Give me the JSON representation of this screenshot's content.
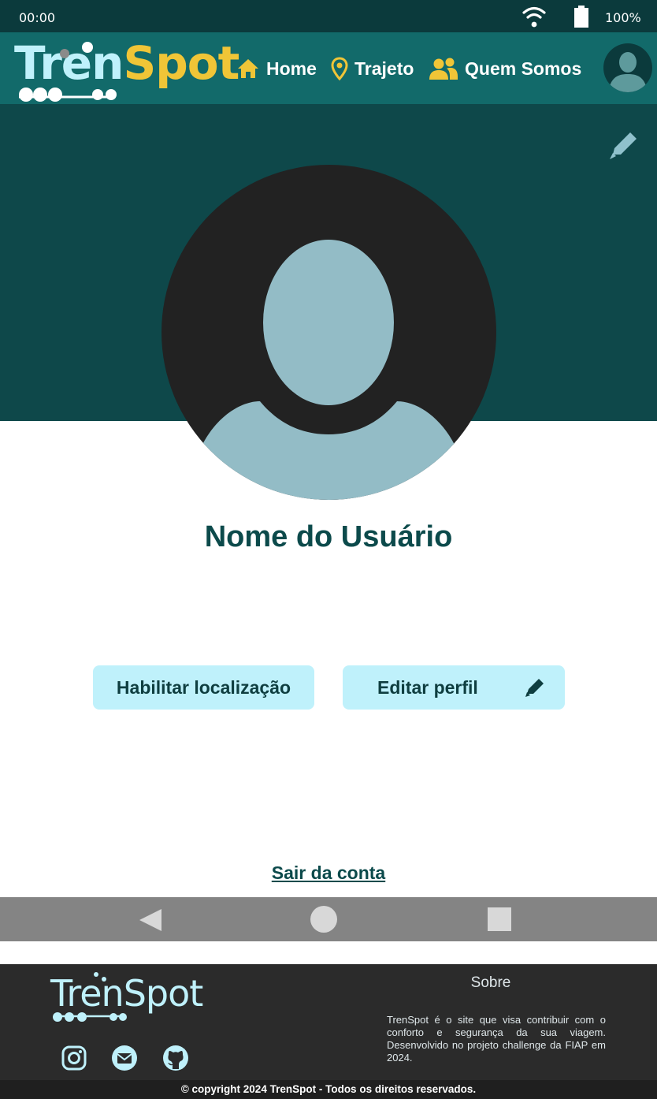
{
  "status_bar": {
    "time": "00:00",
    "battery": "100%",
    "icons": [
      "wifi-icon",
      "battery-icon"
    ]
  },
  "header": {
    "logo": {
      "part1": "Tren",
      "part2": "Spot"
    },
    "nav": [
      {
        "label": "Home",
        "icon": "home-icon"
      },
      {
        "label": "Trajeto",
        "icon": "map-pin-icon"
      },
      {
        "label": "Quem Somos",
        "icon": "users-icon"
      }
    ],
    "avatar_icon": "user-avatar-icon"
  },
  "profile": {
    "edit_icon": "pencil-icon",
    "avatar_icon": "user-avatar-icon",
    "username": "Nome do Usuário",
    "enable_location_label": "Habilitar localização",
    "edit_profile_label": "Editar perfil",
    "logout_label": "Sair da conta"
  },
  "android_nav": {
    "icons": [
      "back-icon",
      "home-circle-icon",
      "recent-apps-icon"
    ]
  },
  "footer": {
    "logo": "TrenSpot",
    "social_icons": [
      "instagram-icon",
      "email-icon",
      "github-icon"
    ],
    "about_title": "Sobre",
    "about_text": "TrenSpot é o site que visa contribuir com o conforto e segurança da sua viagem. Desenvolvido no projeto challenge da FIAP em 2024.",
    "copyright": "© copyright 2024 TrenSpot - Todos os direitos reservados."
  },
  "colors": {
    "status_bar": "#0b3a3c",
    "header": "#126a6a",
    "banner": "#0e484a",
    "accent_light": "#bff1fb",
    "accent_yellow": "#f0c537",
    "text_dark": "#0c4a4b",
    "footer": "#2b2b2b"
  }
}
